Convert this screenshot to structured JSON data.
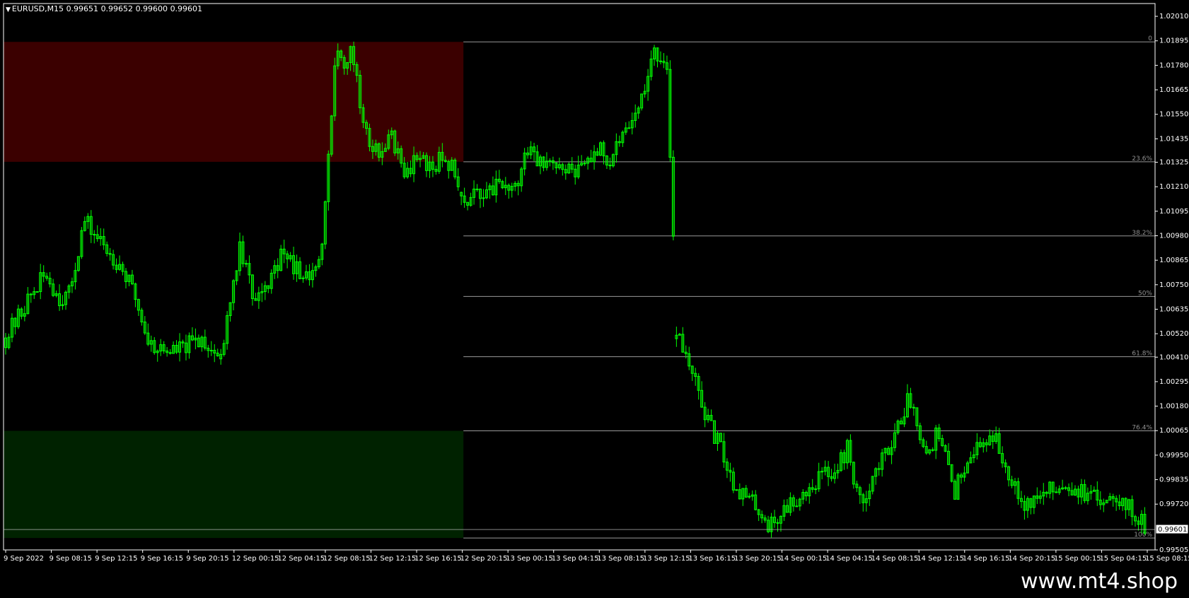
{
  "chart_data": {
    "type": "candlestick",
    "symbol_label": "EURUSD,M15",
    "ohlc_header": [
      "0.99651",
      "0.99652",
      "0.99600",
      "0.99601"
    ],
    "current_price": "0.99601",
    "ylim": [
      0.99505,
      1.0207
    ],
    "y_ticks": [
      "1.02010",
      "1.01895",
      "1.01780",
      "1.01665",
      "1.01550",
      "1.01435",
      "1.01325",
      "1.01210",
      "1.01095",
      "1.00980",
      "1.00865",
      "1.00750",
      "1.00635",
      "1.00520",
      "1.00410",
      "1.00295",
      "1.00180",
      "1.00065",
      "0.99950",
      "0.99835",
      "0.99720",
      "0.99601",
      "0.99505"
    ],
    "x_ticks": [
      "9 Sep 2022",
      "9 Sep 08:15",
      "9 Sep 12:15",
      "9 Sep 16:15",
      "9 Sep 20:15",
      "12 Sep 00:15",
      "12 Sep 04:15",
      "12 Sep 08:15",
      "12 Sep 12:15",
      "12 Sep 16:15",
      "12 Sep 20:15",
      "13 Sep 00:15",
      "13 Sep 04:15",
      "13 Sep 08:15",
      "13 Sep 12:15",
      "13 Sep 16:15",
      "13 Sep 20:15",
      "14 Sep 00:15",
      "14 Sep 04:15",
      "14 Sep 08:15",
      "14 Sep 12:15",
      "14 Sep 16:15",
      "14 Sep 20:15",
      "15 Sep 00:15",
      "15 Sep 04:15",
      "15 Sep 08:15"
    ],
    "price_path": [
      [
        0,
        1.005
      ],
      [
        2,
        1.007
      ],
      [
        3.2,
        1.008
      ],
      [
        4.2,
        1.0069
      ],
      [
        5,
        1.007
      ],
      [
        6.2,
        1.0105
      ],
      [
        7.5,
        1.0095
      ],
      [
        8.2,
        1.009
      ],
      [
        9,
        1.0085
      ],
      [
        10.2,
        1.007
      ],
      [
        11.3,
        1.0048
      ],
      [
        12.5,
        1.0044
      ],
      [
        14,
        1.0045
      ],
      [
        15.5,
        1.005
      ],
      [
        17,
        1.004
      ],
      [
        18.5,
        1.0093
      ],
      [
        19,
        1.0085
      ],
      [
        19.5,
        1.0068
      ],
      [
        20.5,
        1.0075
      ],
      [
        22,
        1.009
      ],
      [
        23,
        1.0082
      ],
      [
        24,
        1.0078
      ],
      [
        25,
        1.0093
      ],
      [
        25.7,
        1.0155
      ],
      [
        26.2,
        1.019
      ],
      [
        26.8,
        1.018
      ],
      [
        27.3,
        1.0185
      ],
      [
        28,
        1.016
      ],
      [
        28.8,
        1.014
      ],
      [
        29.8,
        1.0135
      ],
      [
        30.5,
        1.0145
      ],
      [
        31.5,
        1.0125
      ],
      [
        32.5,
        1.0135
      ],
      [
        33.5,
        1.013
      ],
      [
        34.5,
        1.0135
      ],
      [
        35.5,
        1.013
      ],
      [
        35.8,
        1.0118
      ],
      [
        36.5,
        1.0115
      ],
      [
        37.5,
        1.0118
      ],
      [
        38.5,
        1.012
      ],
      [
        39.5,
        1.0122
      ],
      [
        40.5,
        1.0125
      ],
      [
        41.2,
        1.0138
      ],
      [
        42,
        1.0133
      ],
      [
        43,
        1.013
      ],
      [
        44,
        1.0128
      ],
      [
        45,
        1.0127
      ],
      [
        46,
        1.0135
      ],
      [
        47,
        1.014
      ],
      [
        47.8,
        1.0132
      ],
      [
        48.5,
        1.0142
      ],
      [
        49.5,
        1.0152
      ],
      [
        50.5,
        1.0165
      ],
      [
        51.3,
        1.0185
      ],
      [
        52,
        1.0178
      ],
      [
        52.3,
        1.0172
      ],
      [
        53,
        1.0055
      ],
      [
        53.8,
        1.004
      ],
      [
        54.5,
        1.0028
      ],
      [
        55.5,
        1.001
      ],
      [
        56.5,
        0.9998
      ],
      [
        57.5,
        0.9982
      ],
      [
        58.5,
        0.9975
      ],
      [
        59.5,
        0.997
      ],
      [
        60.3,
        0.9962
      ],
      [
        61,
        0.9965
      ],
      [
        61.5,
        0.997
      ],
      [
        62.5,
        0.9975
      ],
      [
        63.5,
        0.998
      ],
      [
        64.5,
        0.9986
      ],
      [
        65.5,
        0.9988
      ],
      [
        66.5,
        0.9998
      ],
      [
        67,
        0.9985
      ],
      [
        67.5,
        0.9972
      ],
      [
        68.5,
        0.9985
      ],
      [
        69.5,
        0.9995
      ],
      [
        70.5,
        1.001
      ],
      [
        71.4,
        1.0022
      ],
      [
        72,
        1.0012
      ],
      [
        72.8,
        0.9995
      ],
      [
        73.5,
        1.0005
      ],
      [
        74.5,
        0.999
      ],
      [
        75,
        0.9978
      ],
      [
        76,
        0.9995
      ],
      [
        77,
        1.0
      ],
      [
        78,
        1.0005
      ],
      [
        79,
        0.999
      ],
      [
        79.8,
        0.9982
      ],
      [
        80.5,
        0.9972
      ],
      [
        81.5,
        0.9975
      ],
      [
        82.5,
        0.9978
      ],
      [
        83.5,
        0.9982
      ],
      [
        84.5,
        0.998
      ],
      [
        85.5,
        0.9975
      ],
      [
        86.5,
        0.9974
      ],
      [
        87.5,
        0.9978
      ],
      [
        88.5,
        0.9972
      ],
      [
        89.5,
        0.9965
      ],
      [
        90.2,
        0.996
      ]
    ],
    "segment_gaps": [
      17,
      36,
      53
    ],
    "fibonacci": {
      "levels": [
        {
          "label": "0",
          "price": 1.0189
        },
        {
          "label": "23.6%",
          "price": 1.01327
        },
        {
          "label": "38.2%",
          "price": 1.00979
        },
        {
          "label": "50%",
          "price": 1.00695
        },
        {
          "label": "61.8%",
          "price": 1.00412
        },
        {
          "label": "76.4%",
          "price": 1.00064
        },
        {
          "label": "100%",
          "price": 0.99561
        }
      ],
      "line_color": "#c0c0c0"
    },
    "zones": [
      {
        "name": "supply-zone",
        "from_bar": 0,
        "to_bar": 36,
        "price_top": 1.0189,
        "price_bottom": 1.01327,
        "color": "#3b0000"
      },
      {
        "name": "demand-zone",
        "from_bar": 0,
        "to_bar": 36,
        "price_top": 1.00064,
        "price_bottom": 0.99561,
        "color": "#002200"
      }
    ],
    "total_bars": 90.2,
    "colors": {
      "candle": "#00ff00",
      "background": "#000000",
      "axis": "#ffffff",
      "text": "#ffffff"
    },
    "grid": false
  },
  "watermark": "www.mt4.shop"
}
